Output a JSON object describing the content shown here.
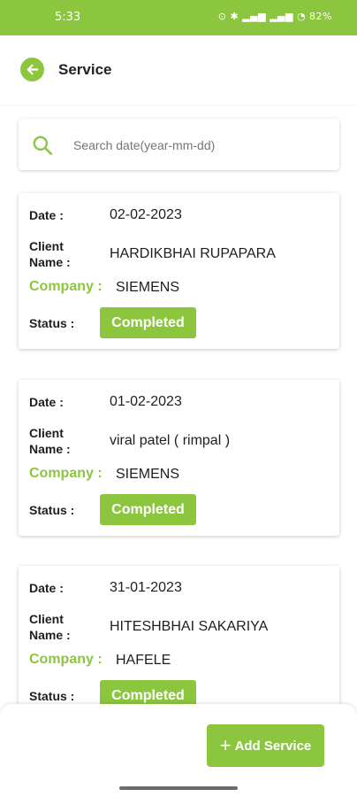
{
  "status_bar": {
    "time": "5:33",
    "battery": "82%"
  },
  "header": {
    "title": "Service"
  },
  "search": {
    "placeholder": "Search date(year-mm-dd)"
  },
  "labels": {
    "date": "Date :",
    "client": "Client Name :",
    "company": "Company :",
    "status": "Status :"
  },
  "services": [
    {
      "date": "02-02-2023",
      "client": "HARDIKBHAI RUPAPARA",
      "company": "SIEMENS",
      "status": "Completed"
    },
    {
      "date": "01-02-2023",
      "client": "viral patel ( rimpal )",
      "company": "SIEMENS",
      "status": "Completed"
    },
    {
      "date": "31-01-2023",
      "client": "HITESHBHAI SAKARIYA",
      "company": "HAFELE",
      "status": "Completed"
    }
  ],
  "actions": {
    "add_service": "Add Service"
  },
  "colors": {
    "accent": "#8cc63f"
  }
}
